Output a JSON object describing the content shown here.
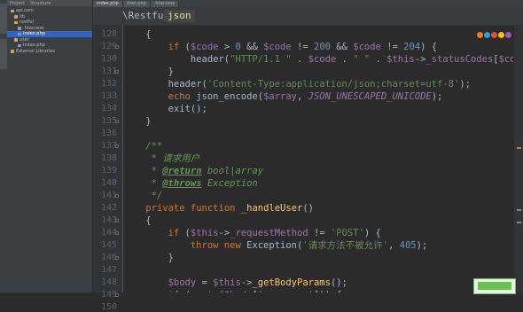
{
  "project_panel": {
    "header_tabs": [
      "Project",
      "Structure"
    ],
    "tree": [
      {
        "label": "api.com",
        "selected": false,
        "type": "folder"
      },
      {
        "label": "lib",
        "selected": false,
        "type": "folder"
      },
      {
        "label": "restful",
        "selected": false,
        "type": "folder"
      },
      {
        "label": ".htaccess",
        "selected": false,
        "type": "file"
      },
      {
        "label": "index.php",
        "selected": true,
        "type": "file"
      },
      {
        "label": "user",
        "selected": false,
        "type": "folder"
      },
      {
        "label": "index.php",
        "selected": false,
        "type": "file"
      },
      {
        "label": "External Libraries",
        "selected": false,
        "type": "folder"
      }
    ]
  },
  "tabs": [
    "index.php",
    "User.php",
    ".htaccess"
  ],
  "breadcrumb": {
    "class_name": "\\Restful",
    "method_name": "json"
  },
  "code_lines": [
    {
      "n": 128,
      "code": "    {"
    },
    {
      "n": 129,
      "code": "        if ($code > 0 && $code != 200 && $code != 204) {"
    },
    {
      "n": 130,
      "code": "            header(\"HTTP/1.1 \" . $code . \" \" . $this->_statusCodes[$code]);"
    },
    {
      "n": 131,
      "code": "        }"
    },
    {
      "n": 132,
      "code": "        header('Content-Type:application/json;charset=utf-8');"
    },
    {
      "n": 133,
      "code": "        echo json_encode($array, JSON_UNESCAPED_UNICODE);"
    },
    {
      "n": 134,
      "code": "        exit();"
    },
    {
      "n": 135,
      "code": "    }"
    },
    {
      "n": 136,
      "code": ""
    },
    {
      "n": 137,
      "code": "    /**"
    },
    {
      "n": 138,
      "code": "     * 请求用户"
    },
    {
      "n": 139,
      "code": "     * @return bool|array"
    },
    {
      "n": 140,
      "code": "     * @throws Exception"
    },
    {
      "n": 141,
      "code": "     */"
    },
    {
      "n": 142,
      "code": "    private function _handleUser()"
    },
    {
      "n": 143,
      "code": "    {"
    },
    {
      "n": 144,
      "code": "        if ($this->_requestMethod != 'POST') {"
    },
    {
      "n": 145,
      "code": "            throw new Exception('请求方法不被允许', 405);"
    },
    {
      "n": 146,
      "code": "        }"
    },
    {
      "n": 147,
      "code": ""
    },
    {
      "n": 148,
      "code": "        $body = $this->_getBodyParams();"
    },
    {
      "n": 149,
      "code": "        if (empty($body['username'])) {"
    },
    {
      "n": 150,
      "code": "            throw new Exception('用户名不能为空', 400);"
    }
  ],
  "colors": {
    "background": "#2b2b2b",
    "keyword": "#cc7832",
    "variable": "#9876aa",
    "string": "#6a8759",
    "number": "#6897bb",
    "function": "#ffc66d",
    "comment": "#629755",
    "selection": "#2f65ca"
  }
}
